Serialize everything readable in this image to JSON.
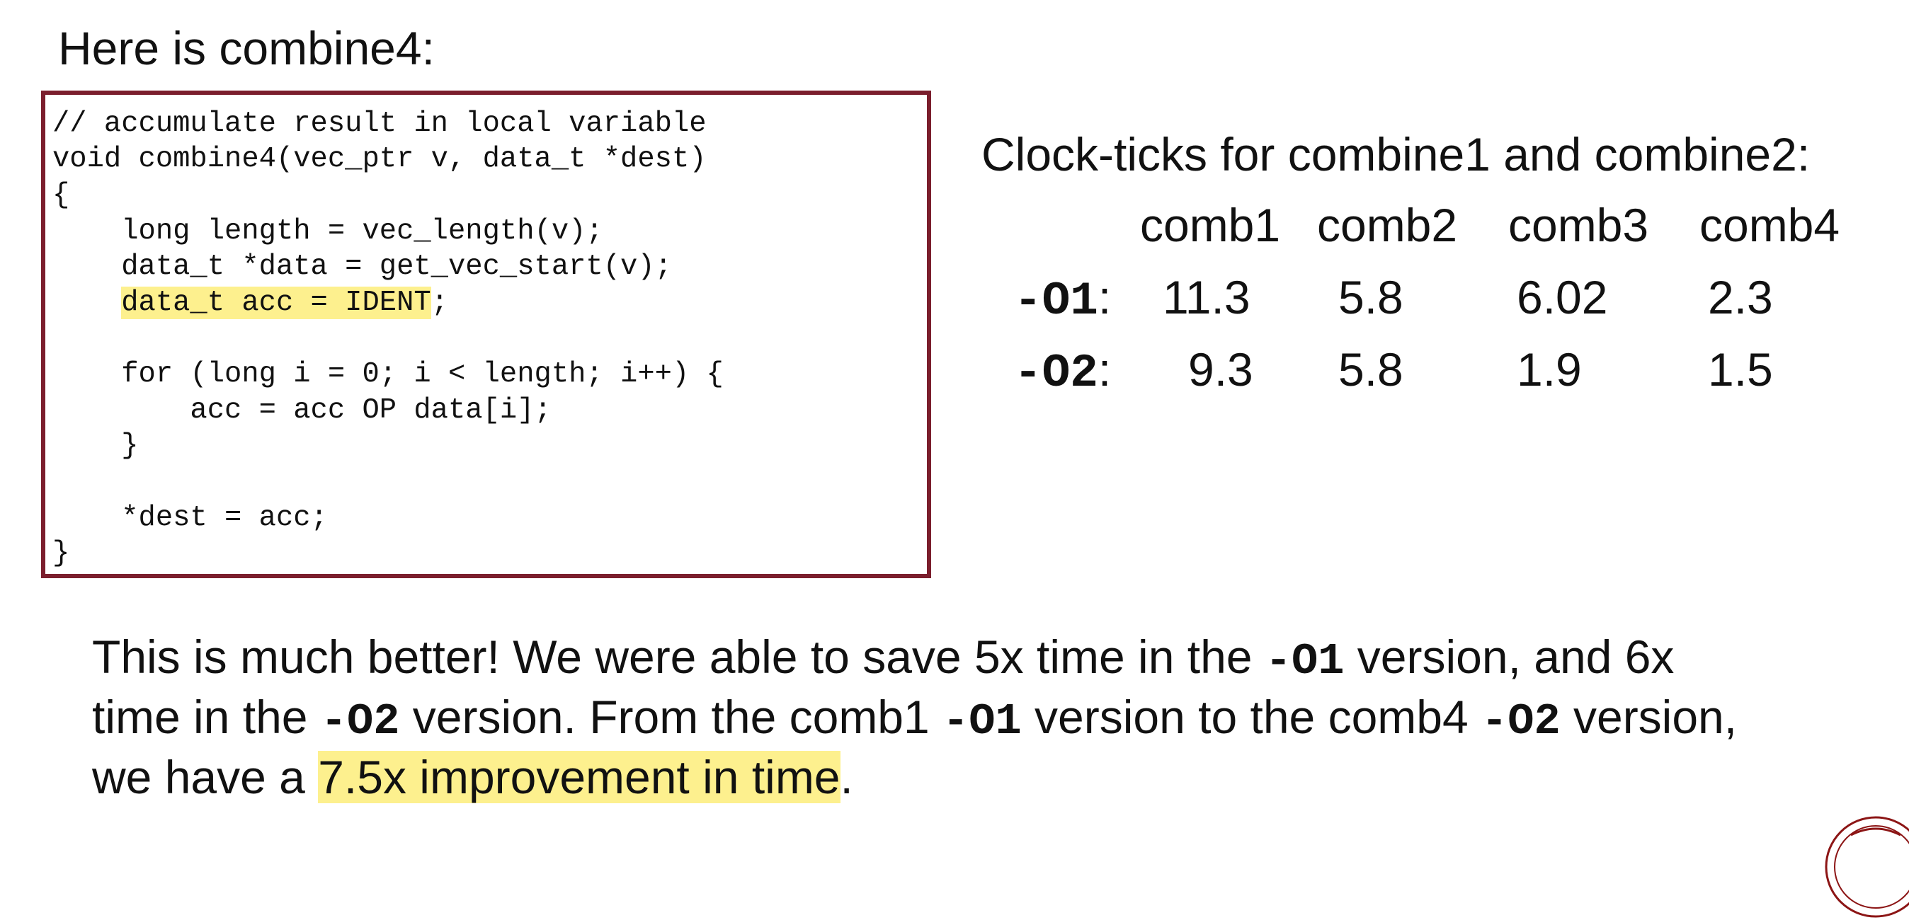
{
  "slide": {
    "title": "Here is combine4:"
  },
  "code": {
    "lines": [
      "// accumulate result in local variable",
      "void combine4(vec_ptr v, data_t *dest)",
      "{",
      "    long length = vec_length(v);",
      "    data_t *data = get_vec_start(v);",
      "    ",
      "",
      "    for (long i = 0; i < length; i++) {",
      "        acc = acc OP data[i];",
      "    }",
      "",
      "    *dest = acc;",
      "}"
    ],
    "highlighted_text": "data_t acc = IDENT",
    "highlighted_suffix": ";"
  },
  "table": {
    "heading": "Clock-ticks for combine1 and combine2:",
    "columns": [
      "comb1",
      "comb2",
      "comb3",
      "comb4"
    ],
    "rows": [
      {
        "prefix": "-O1",
        "suffix": ":",
        "values": [
          "11.3",
          "5.8",
          "6.02",
          "2.3"
        ]
      },
      {
        "prefix": "-O2",
        "suffix": ":",
        "values": [
          "9.3",
          "5.8",
          "1.9",
          "1.5"
        ]
      }
    ]
  },
  "paragraph": {
    "l1_a": "This is much better! We were able to save 5x time in the ",
    "l1_code": "-O1",
    "l1_b": " version, and 6x",
    "l2_a": "time in the ",
    "l2_code1": "-O2",
    "l2_b": " version. From the comb1 ",
    "l2_code2": "-O1",
    "l2_c": " version to the comb4 ",
    "l2_code3": "-O2",
    "l2_d": " version,",
    "l3_a": "we have a ",
    "l3_highlight": "7.5x improvement in time",
    "l3_b": "."
  },
  "colors": {
    "code_border": "#7b1e2d",
    "highlight": "#fdf08e",
    "seal": "#8c1515"
  }
}
